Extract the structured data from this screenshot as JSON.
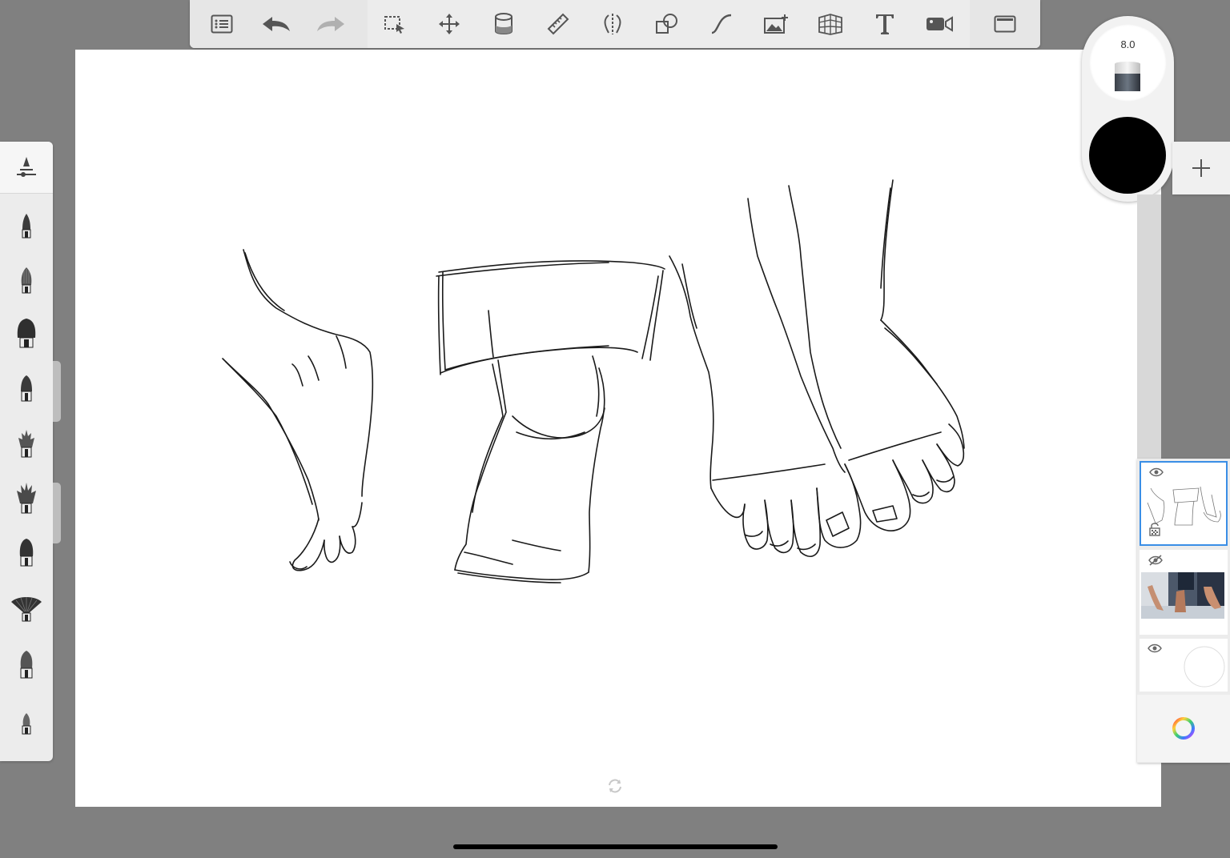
{
  "toolbar": {
    "left_buttons": [
      {
        "name": "layer-list-icon"
      },
      {
        "name": "undo-icon"
      },
      {
        "name": "redo-icon"
      }
    ],
    "tools": [
      {
        "name": "selection-icon"
      },
      {
        "name": "transform-icon"
      },
      {
        "name": "fill-icon"
      },
      {
        "name": "ruler-icon"
      },
      {
        "name": "symmetry-icon"
      },
      {
        "name": "shapes-icon"
      },
      {
        "name": "curve-icon"
      },
      {
        "name": "import-image-icon"
      },
      {
        "name": "perspective-grid-icon"
      },
      {
        "name": "text-icon"
      },
      {
        "name": "time-lapse-video-icon"
      }
    ],
    "right_button": {
      "name": "fullscreen-icon"
    }
  },
  "brush_panel": {
    "header_icon": "brush-properties-icon",
    "brushes": [
      {
        "name": "pencil-brush"
      },
      {
        "name": "round-brush"
      },
      {
        "name": "flat-brush"
      },
      {
        "name": "marker-brush"
      },
      {
        "name": "spiky-brush"
      },
      {
        "name": "bristle-brush"
      },
      {
        "name": "chisel-brush"
      },
      {
        "name": "fan-brush"
      },
      {
        "name": "soft-brush"
      },
      {
        "name": "fine-brush"
      }
    ]
  },
  "puck": {
    "brush_size": "8.0",
    "active_tool": "eraser-icon",
    "current_color": "#000000"
  },
  "layers": {
    "add_icon": "plus-icon",
    "items": [
      {
        "name": "sketch-layer",
        "visible": true,
        "selected": true
      },
      {
        "name": "reference-photo-layer",
        "visible": false,
        "selected": false
      },
      {
        "name": "background-layer",
        "visible": true,
        "selected": false
      }
    ],
    "color_wheel_icon": "color-wheel-icon"
  },
  "colors": {
    "selection_accent": "#3a8ee6",
    "workspace": "#808080",
    "canvas": "#ffffff"
  }
}
